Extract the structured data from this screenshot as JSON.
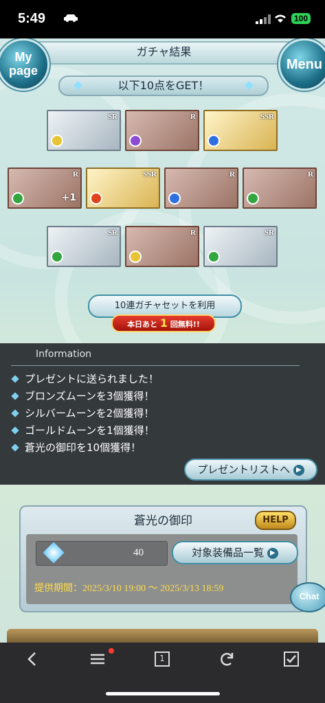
{
  "status": {
    "time": "5:49",
    "battery": "100"
  },
  "header": {
    "title": "ガチャ結果",
    "mypage_line1": "My",
    "mypage_line2": "page",
    "menu": "Menu"
  },
  "get_banner": "以下10点をGET！",
  "cards": [
    {
      "rarity": "SR",
      "element": "light",
      "color": "#e6c433"
    },
    {
      "rarity": "R",
      "element": "dark",
      "color": "#8b4bd4"
    },
    {
      "rarity": "SSR",
      "element": "water",
      "color": "#2f6fe0"
    },
    {
      "rarity": "R",
      "element": "wind",
      "color": "#34a640",
      "plus": "+1"
    },
    {
      "rarity": "SSR",
      "element": "fire",
      "color": "#e0421b"
    },
    {
      "rarity": "R",
      "element": "water",
      "color": "#2f6fe0"
    },
    {
      "rarity": "R",
      "element": "wind",
      "color": "#34a640"
    },
    {
      "rarity": "SR",
      "element": "wind",
      "color": "#34a640"
    },
    {
      "rarity": "R",
      "element": "light",
      "color": "#e6c433"
    },
    {
      "rarity": "SR",
      "element": "wind",
      "color": "#34a640"
    }
  ],
  "set_button": "10連ガチャセットを利用",
  "free_badge": {
    "pre": "本日あと",
    "num": "1",
    "post": "回無料!!"
  },
  "info": {
    "title": "Information",
    "items": [
      "プレゼントに送られました！",
      "ブロンズムーンを3個獲得！",
      "シルバームーンを2個獲得！",
      "ゴールドムーンを1個獲得！",
      "蒼光の御印を10個獲得！"
    ],
    "present_button": "プレゼントリストへ"
  },
  "panel": {
    "title": "蒼光の御印",
    "help": "HELP",
    "count": "40",
    "equip_button": "対象装備品一覧",
    "period": "提供期間：2025/3/10 19:00 〜 2025/3/13 18:59"
  },
  "chat": "Chat",
  "toolbar_icons": [
    "back-icon",
    "menu-list-icon",
    "tab-count-icon",
    "reload-icon",
    "checkbox-icon"
  ],
  "toolbar_tab_count": "1"
}
